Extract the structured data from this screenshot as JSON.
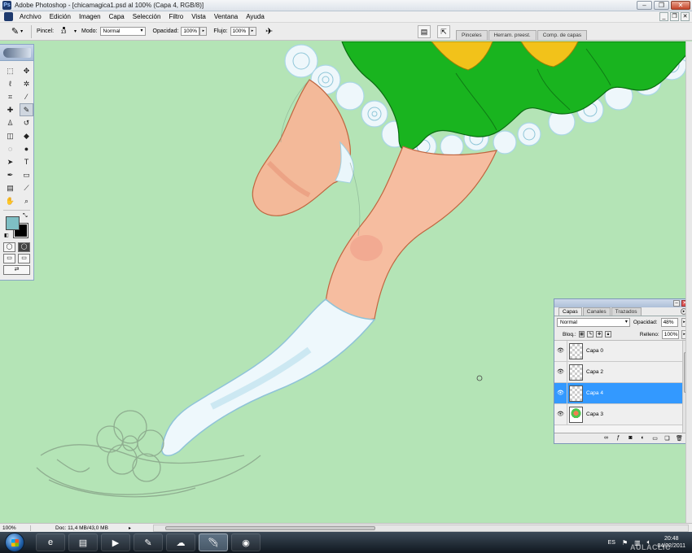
{
  "window": {
    "title": "Adobe Photoshop - [chicamagica1.psd al 100% (Capa 4, RGB/8)]",
    "controls": {
      "minimize": "–",
      "maximize": "❐",
      "close": "✕"
    }
  },
  "menu": {
    "items": [
      "Archivo",
      "Edición",
      "Imagen",
      "Capa",
      "Selección",
      "Filtro",
      "Vista",
      "Ventana",
      "Ayuda"
    ],
    "doc_controls": {
      "minimize": "_",
      "restore": "❐",
      "close": "✕"
    }
  },
  "options": {
    "brush_label": "Pincel:",
    "brush_size": "13",
    "mode_label": "Modo:",
    "mode_value": "Normal",
    "opacity_label": "Opacidad:",
    "opacity_value": "100%",
    "flow_label": "Flujo:",
    "flow_value": "100%",
    "palette_tabs": [
      "Pinceles",
      "Herram. preest.",
      "Comp. de capas"
    ]
  },
  "tools": {
    "foreground_color": "#7fbfc4",
    "background_color": "#000000",
    "items": [
      {
        "name": "marquee-tool-icon",
        "glyph": "⬚"
      },
      {
        "name": "move-tool-icon",
        "glyph": "✥"
      },
      {
        "name": "lasso-tool-icon",
        "glyph": "ℓ"
      },
      {
        "name": "magic-wand-tool-icon",
        "glyph": "✲"
      },
      {
        "name": "crop-tool-icon",
        "glyph": "⌗"
      },
      {
        "name": "slice-tool-icon",
        "glyph": "⁄"
      },
      {
        "name": "healing-brush-tool-icon",
        "glyph": "✚"
      },
      {
        "name": "brush-tool-icon",
        "glyph": "✎"
      },
      {
        "name": "clone-stamp-tool-icon",
        "glyph": "♙"
      },
      {
        "name": "history-brush-tool-icon",
        "glyph": "↺"
      },
      {
        "name": "eraser-tool-icon",
        "glyph": "◫"
      },
      {
        "name": "paint-bucket-tool-icon",
        "glyph": "◆"
      },
      {
        "name": "blur-tool-icon",
        "glyph": "◌"
      },
      {
        "name": "dodge-tool-icon",
        "glyph": "●"
      },
      {
        "name": "path-selection-tool-icon",
        "glyph": "➤"
      },
      {
        "name": "type-tool-icon",
        "glyph": "T"
      },
      {
        "name": "pen-tool-icon",
        "glyph": "✒"
      },
      {
        "name": "shape-tool-icon",
        "glyph": "▭"
      },
      {
        "name": "notes-tool-icon",
        "glyph": "▤"
      },
      {
        "name": "eyedropper-tool-icon",
        "glyph": "⟋"
      },
      {
        "name": "hand-tool-icon",
        "glyph": "✋"
      },
      {
        "name": "zoom-tool-icon",
        "glyph": "⌕"
      }
    ]
  },
  "layers": {
    "tabs": [
      "Capas",
      "Canales",
      "Trazados"
    ],
    "blend_mode": "Normal",
    "opacity_label": "Opacidad:",
    "opacity_value": "48%",
    "lock_label": "Bloq.:",
    "fill_label": "Relleno:",
    "fill_value": "100%",
    "items": [
      {
        "name": "Capa 0",
        "selected": false
      },
      {
        "name": "Capa 2",
        "selected": false
      },
      {
        "name": "Capa 4",
        "selected": true
      },
      {
        "name": "Capa 3",
        "selected": false
      }
    ],
    "selected_color": "#3399ff"
  },
  "status": {
    "zoom": "100%",
    "doc": "Doc: 11,4 MB/43,0 MB"
  },
  "taskbar": {
    "language": "ES",
    "time": "20:48",
    "date": "04/02/2011",
    "watermark": "AULACLIC"
  }
}
